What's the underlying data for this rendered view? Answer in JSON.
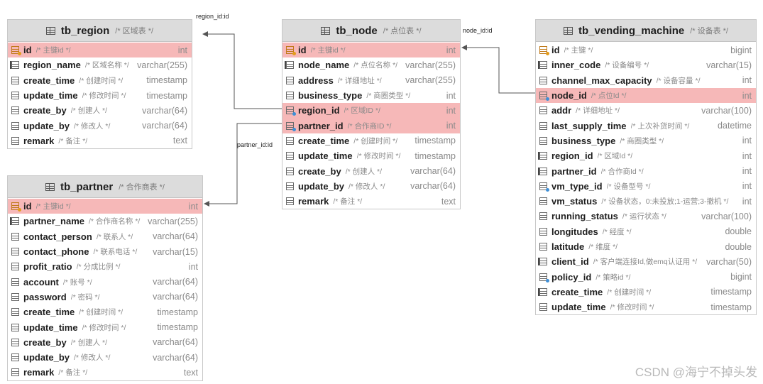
{
  "tables": [
    {
      "id": "region",
      "name": "tb_region",
      "comment": "/* 区域表 */",
      "fields": [
        {
          "name": "id",
          "comment": "/* 主键id */",
          "type": "int",
          "kind": "pk",
          "highlight": true
        },
        {
          "name": "region_name",
          "comment": "/* 区域名称 */",
          "type": "varchar(255)",
          "kind": "nn",
          "highlight": false
        },
        {
          "name": "create_time",
          "comment": "/* 创建时间 */",
          "type": "timestamp",
          "kind": "",
          "highlight": false
        },
        {
          "name": "update_time",
          "comment": "/* 修改时间 */",
          "type": "timestamp",
          "kind": "",
          "highlight": false
        },
        {
          "name": "create_by",
          "comment": "/* 创建人 */",
          "type": "varchar(64)",
          "kind": "",
          "highlight": false
        },
        {
          "name": "update_by",
          "comment": "/* 修改人 */",
          "type": "varchar(64)",
          "kind": "",
          "highlight": false
        },
        {
          "name": "remark",
          "comment": "/* 备注 */",
          "type": "text",
          "kind": "",
          "highlight": false
        }
      ]
    },
    {
      "id": "partner",
      "name": "tb_partner",
      "comment": "/* 合作商表 */",
      "fields": [
        {
          "name": "id",
          "comment": "/* 主键id */",
          "type": "int",
          "kind": "pk",
          "highlight": true
        },
        {
          "name": "partner_name",
          "comment": "/* 合作商名称 */",
          "type": "varchar(255)",
          "kind": "nn",
          "highlight": false
        },
        {
          "name": "contact_person",
          "comment": "/* 联系人 */",
          "type": "varchar(64)",
          "kind": "",
          "highlight": false
        },
        {
          "name": "contact_phone",
          "comment": "/* 联系电话 */",
          "type": "varchar(15)",
          "kind": "",
          "highlight": false
        },
        {
          "name": "profit_ratio",
          "comment": "/* 分成比例 */",
          "type": "int",
          "kind": "",
          "highlight": false
        },
        {
          "name": "account",
          "comment": "/* 账号 */",
          "type": "varchar(64)",
          "kind": "",
          "highlight": false
        },
        {
          "name": "password",
          "comment": "/* 密码 */",
          "type": "varchar(64)",
          "kind": "",
          "highlight": false
        },
        {
          "name": "create_time",
          "comment": "/* 创建时间 */",
          "type": "timestamp",
          "kind": "",
          "highlight": false
        },
        {
          "name": "update_time",
          "comment": "/* 修改时间 */",
          "type": "timestamp",
          "kind": "",
          "highlight": false
        },
        {
          "name": "create_by",
          "comment": "/* 创建人 */",
          "type": "varchar(64)",
          "kind": "",
          "highlight": false
        },
        {
          "name": "update_by",
          "comment": "/* 修改人 */",
          "type": "varchar(64)",
          "kind": "",
          "highlight": false
        },
        {
          "name": "remark",
          "comment": "/* 备注 */",
          "type": "text",
          "kind": "",
          "highlight": false
        }
      ]
    },
    {
      "id": "node",
      "name": "tb_node",
      "comment": "/* 点位表 */",
      "fields": [
        {
          "name": "id",
          "comment": "/* 主键id */",
          "type": "int",
          "kind": "pk",
          "highlight": true
        },
        {
          "name": "node_name",
          "comment": "/* 点位名称 */",
          "type": "varchar(255)",
          "kind": "nn",
          "highlight": false
        },
        {
          "name": "address",
          "comment": "/* 详细地址 */",
          "type": "varchar(255)",
          "kind": "",
          "highlight": false
        },
        {
          "name": "business_type",
          "comment": "/* 商圈类型 */",
          "type": "int",
          "kind": "",
          "highlight": false
        },
        {
          "name": "region_id",
          "comment": "/* 区域ID */",
          "type": "int",
          "kind": "fk",
          "highlight": true
        },
        {
          "name": "partner_id",
          "comment": "/* 合作商ID */",
          "type": "int",
          "kind": "fk",
          "highlight": true
        },
        {
          "name": "create_time",
          "comment": "/* 创建时间 */",
          "type": "timestamp",
          "kind": "",
          "highlight": false
        },
        {
          "name": "update_time",
          "comment": "/* 修改时间 */",
          "type": "timestamp",
          "kind": "",
          "highlight": false
        },
        {
          "name": "create_by",
          "comment": "/* 创建人 */",
          "type": "varchar(64)",
          "kind": "",
          "highlight": false
        },
        {
          "name": "update_by",
          "comment": "/* 修改人 */",
          "type": "varchar(64)",
          "kind": "",
          "highlight": false
        },
        {
          "name": "remark",
          "comment": "/* 备注 */",
          "type": "text",
          "kind": "",
          "highlight": false
        }
      ]
    },
    {
      "id": "vending",
      "name": "tb_vending_machine",
      "comment": "/* 设备表 */",
      "fields": [
        {
          "name": "id",
          "comment": "/* 主键 */",
          "type": "bigint",
          "kind": "pk",
          "highlight": false
        },
        {
          "name": "inner_code",
          "comment": "/* 设备编号 */",
          "type": "varchar(15)",
          "kind": "nn",
          "highlight": false
        },
        {
          "name": "channel_max_capacity",
          "comment": "/* 设备容量 */",
          "type": "int",
          "kind": "",
          "highlight": false
        },
        {
          "name": "node_id",
          "comment": "/* 点位Id */",
          "type": "int",
          "kind": "fk",
          "highlight": true
        },
        {
          "name": "addr",
          "comment": "/* 详细地址 */",
          "type": "varchar(100)",
          "kind": "",
          "highlight": false
        },
        {
          "name": "last_supply_time",
          "comment": "/* 上次补货时间 */",
          "type": "datetime",
          "kind": "",
          "highlight": false
        },
        {
          "name": "business_type",
          "comment": "/* 商圈类型 */",
          "type": "int",
          "kind": "",
          "highlight": false
        },
        {
          "name": "region_id",
          "comment": "/* 区域Id */",
          "type": "int",
          "kind": "nn",
          "highlight": false
        },
        {
          "name": "partner_id",
          "comment": "/* 合作商Id */",
          "type": "int",
          "kind": "nn",
          "highlight": false
        },
        {
          "name": "vm_type_id",
          "comment": "/* 设备型号 */",
          "type": "int",
          "kind": "fk",
          "highlight": false
        },
        {
          "name": "vm_status",
          "comment": "/* 设备状态，0:未投放;1-运营;3-撤机 */",
          "type": "int",
          "kind": "",
          "highlight": false
        },
        {
          "name": "running_status",
          "comment": "/* 运行状态 */",
          "type": "varchar(100)",
          "kind": "",
          "highlight": false
        },
        {
          "name": "longitudes",
          "comment": "/* 经度 */",
          "type": "double",
          "kind": "",
          "highlight": false
        },
        {
          "name": "latitude",
          "comment": "/* 维度 */",
          "type": "double",
          "kind": "",
          "highlight": false
        },
        {
          "name": "client_id",
          "comment": "/* 客户端连接Id,做emq认证用 */",
          "type": "varchar(50)",
          "kind": "nn",
          "highlight": false
        },
        {
          "name": "policy_id",
          "comment": "/* 策略id */",
          "type": "bigint",
          "kind": "fk",
          "highlight": false
        },
        {
          "name": "create_time",
          "comment": "/* 创建时间 */",
          "type": "timestamp",
          "kind": "nn",
          "highlight": false
        },
        {
          "name": "update_time",
          "comment": "/* 修改时间 */",
          "type": "timestamp",
          "kind": "",
          "highlight": false
        }
      ]
    }
  ],
  "relations": [
    {
      "label": "region_id:id"
    },
    {
      "label": "partner_id:id"
    },
    {
      "label": "node_id:id"
    }
  ],
  "watermark": "CSDN @海宁不掉头发"
}
